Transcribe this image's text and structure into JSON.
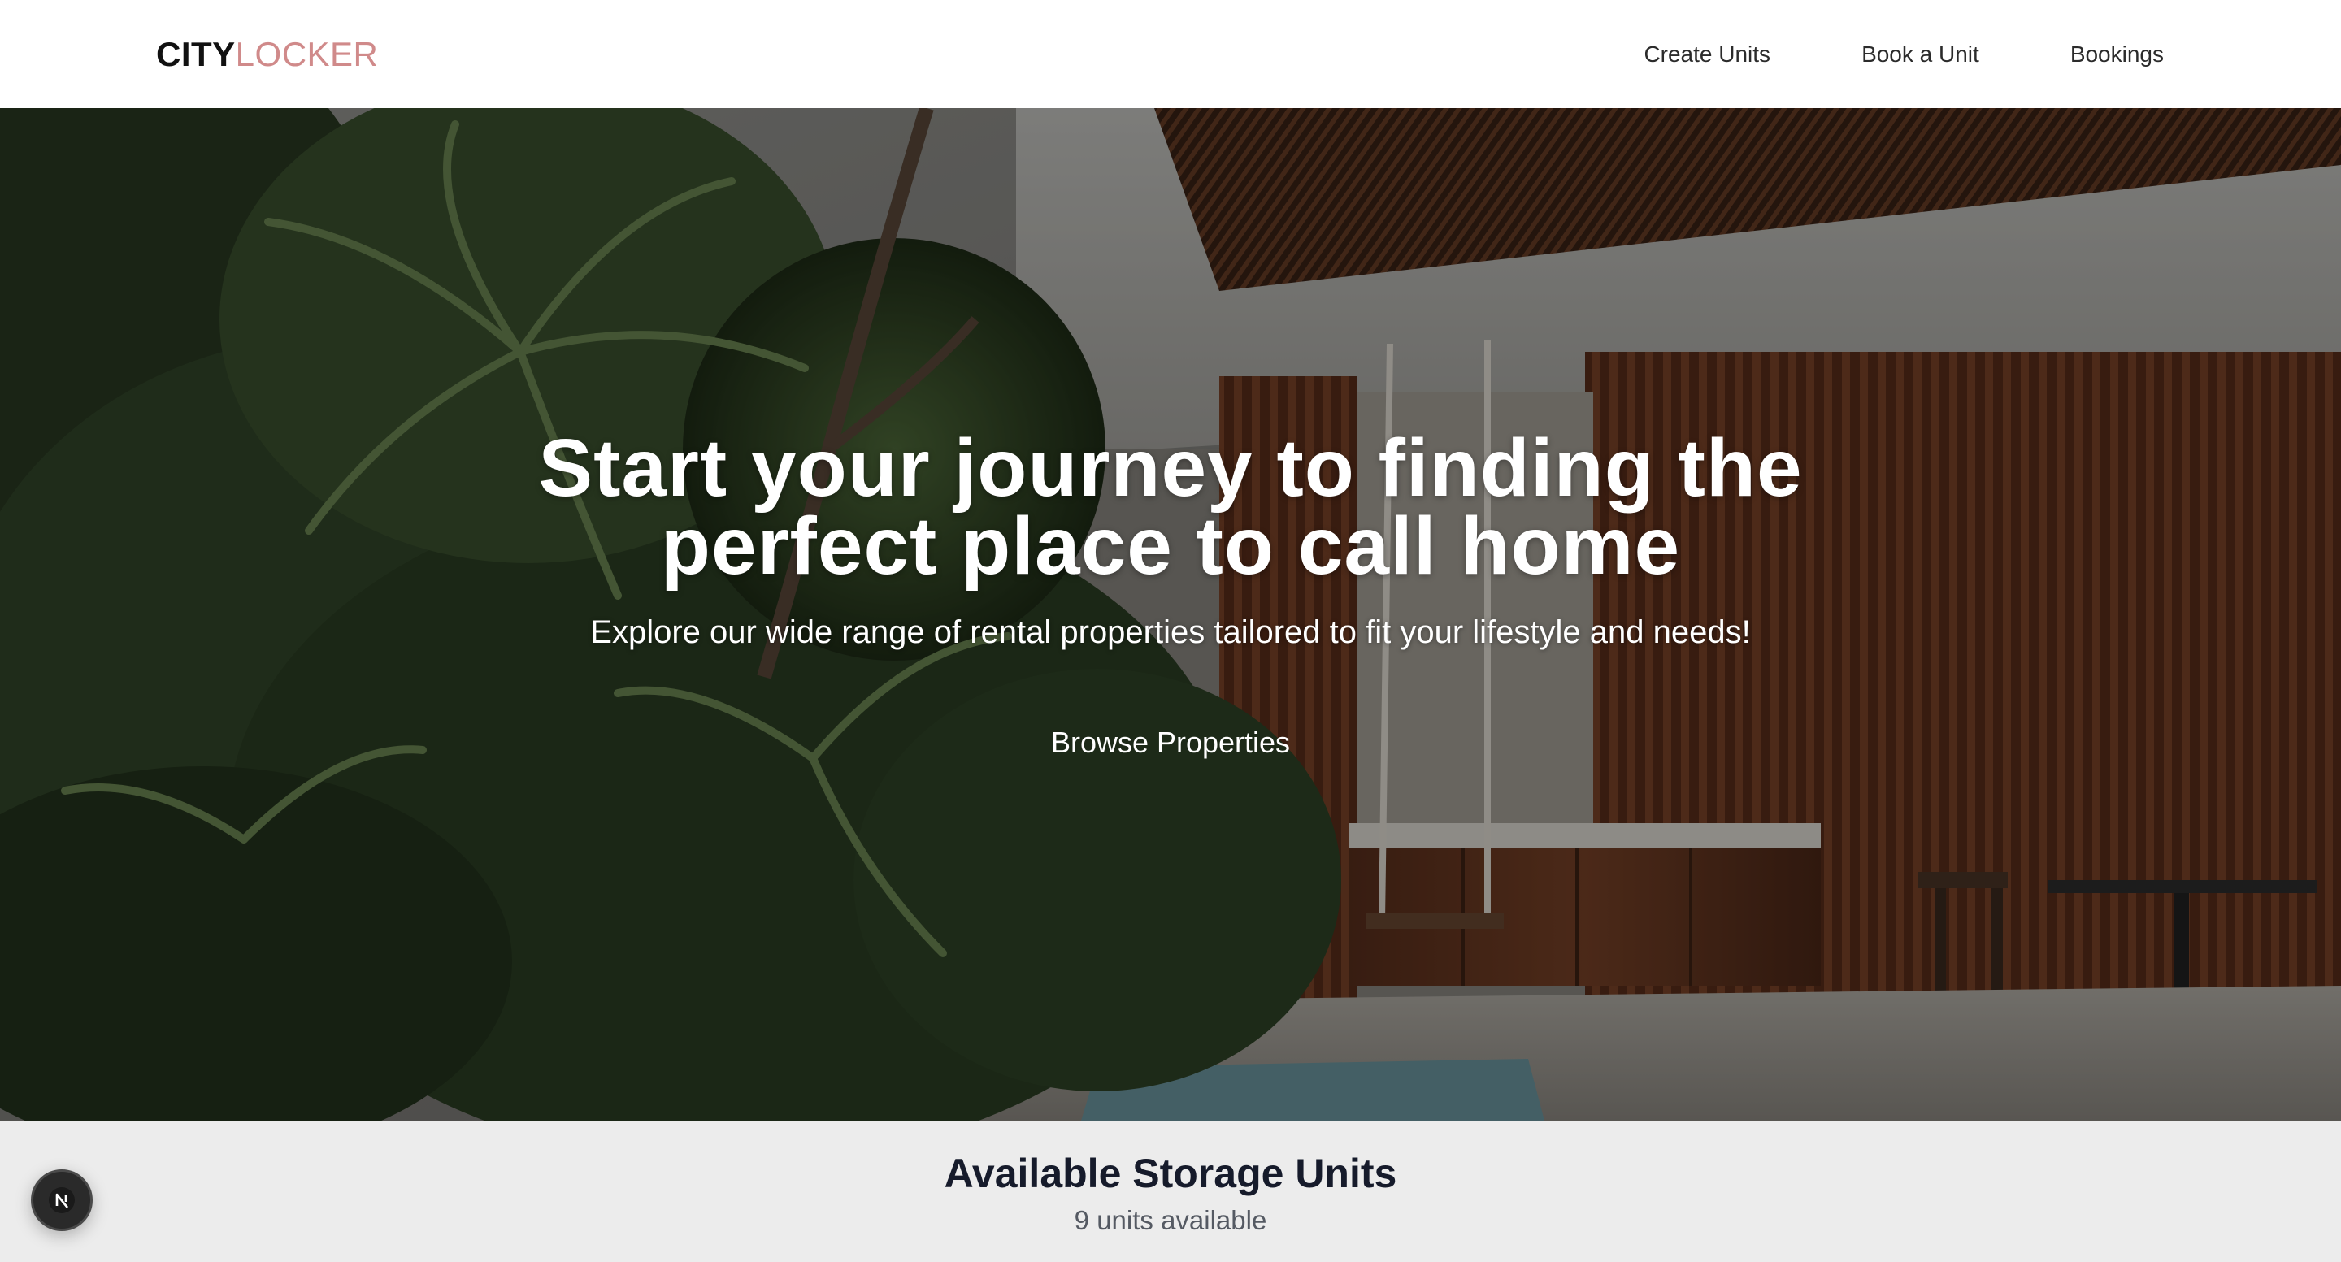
{
  "header": {
    "logo": {
      "part1": "CITY",
      "part2": "LOCKER"
    },
    "nav": [
      {
        "label": "Create Units"
      },
      {
        "label": "Book a Unit"
      },
      {
        "label": "Bookings"
      }
    ]
  },
  "hero": {
    "title": "Start your journey to finding the perfect place to call home",
    "subtitle": "Explore our wide range of rental properties tailored to fit your lifestyle and needs!",
    "cta_label": "Browse Properties"
  },
  "listing": {
    "title": "Available Storage Units",
    "count_text": "9 units available"
  },
  "dev_badge": {
    "icon": "nextjs-logo-icon"
  },
  "colors": {
    "accent": "#d08a8a",
    "heading": "#161b2b",
    "header_bg": "#ffffff",
    "section_bg": "#ececec"
  }
}
